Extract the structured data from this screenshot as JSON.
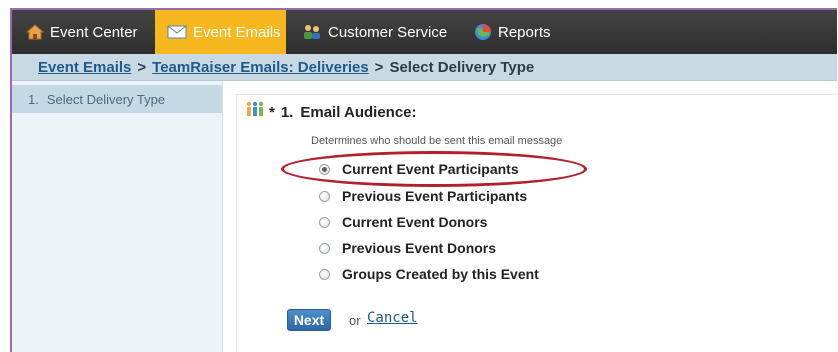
{
  "topnav": {
    "tabs": [
      {
        "label": "Event Center",
        "icon": "house-icon"
      },
      {
        "label": "Event Emails",
        "icon": "envelope-icon",
        "active": true
      },
      {
        "label": "Customer Service",
        "icon": "people-icon"
      },
      {
        "label": "Reports",
        "icon": "globe-chart-icon"
      }
    ]
  },
  "breadcrumb": {
    "items": [
      "Event Emails",
      "TeamRaiser Emails: Deliveries"
    ],
    "separator": ">",
    "current": "Select Delivery Type"
  },
  "sidebar": {
    "items": [
      {
        "number": "1.",
        "label": "Select Delivery Type"
      }
    ]
  },
  "main": {
    "section": {
      "required_mark": "*",
      "number": "1.",
      "title": "Email Audience:",
      "help": "Determines who should be sent this email message"
    },
    "options": [
      {
        "label": "Current Event Participants",
        "checked": true
      },
      {
        "label": "Previous Event Participants",
        "checked": false
      },
      {
        "label": "Current Event Donors",
        "checked": false
      },
      {
        "label": "Previous Event Donors",
        "checked": false
      },
      {
        "label": "Groups Created by this Event",
        "checked": false
      }
    ],
    "next_label": "Next",
    "or_text": "or",
    "cancel_label": "Cancel"
  },
  "colors": {
    "nav_bg": "#3a3a3a",
    "nav_active": "#f7b71f",
    "crumb_bg": "#c9d9e4",
    "link": "#1f5a8a",
    "highlight": "#b3202a",
    "button": "#2c67a6"
  }
}
